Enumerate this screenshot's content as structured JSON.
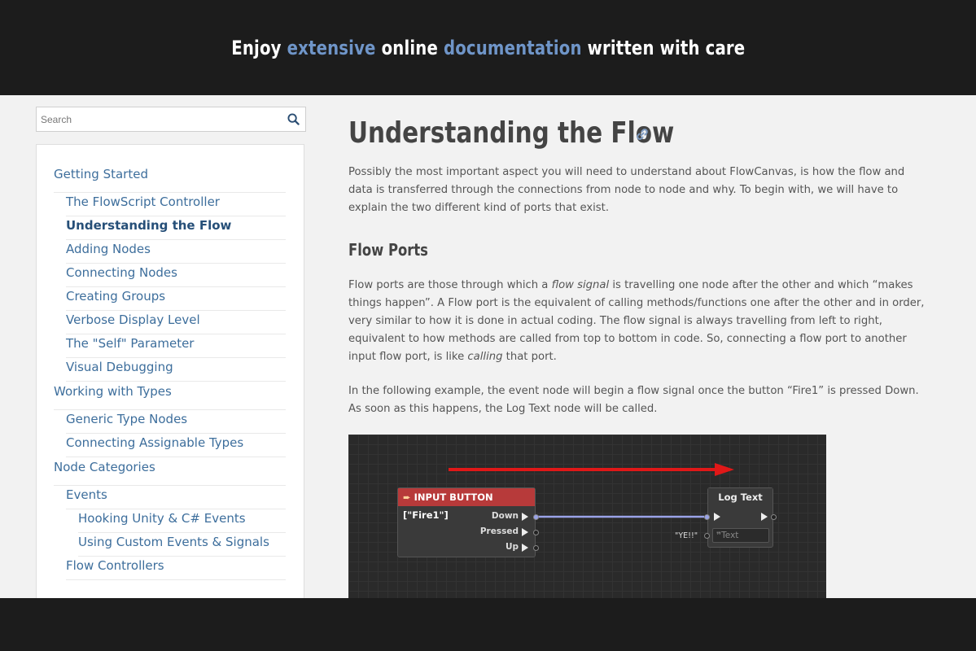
{
  "banner": {
    "w1": "Enjoy",
    "w2": "extensive",
    "w3": "online",
    "w4": "documentation",
    "w5": "written with care",
    "accent_color": "#6f95c8"
  },
  "search": {
    "placeholder": "Search",
    "icon": "search-icon"
  },
  "nav": {
    "items": [
      {
        "label": "Getting Started",
        "level": 1
      },
      {
        "label": "The FlowScript Controller",
        "level": 2
      },
      {
        "label": "Understanding the Flow",
        "level": 2,
        "active": true
      },
      {
        "label": "Adding Nodes",
        "level": 2
      },
      {
        "label": "Connecting Nodes",
        "level": 2
      },
      {
        "label": "Creating Groups",
        "level": 2
      },
      {
        "label": "Verbose Display Level",
        "level": 2
      },
      {
        "label": "The \"Self\" Parameter",
        "level": 2
      },
      {
        "label": "Visual Debugging",
        "level": 2
      },
      {
        "label": "Working with Types",
        "level": 1
      },
      {
        "label": "Generic Type Nodes",
        "level": 2
      },
      {
        "label": "Connecting Assignable Types",
        "level": 2
      },
      {
        "label": "Node Categories",
        "level": 1
      },
      {
        "label": "Events",
        "level": 2
      },
      {
        "label": "Hooking Unity & C# Events",
        "level": 3
      },
      {
        "label": "Using Custom Events & Signals",
        "level": 3
      },
      {
        "label": "Flow Controllers",
        "level": 2
      }
    ]
  },
  "article": {
    "title": "Understanding the Flow",
    "intro": "Possibly the most important aspect you will need to understand about FlowCanvas, is how the flow and data is transferred through the connections from node to node and why. To begin with, we will have to explain the two different kind of ports that exist.",
    "section_title": "Flow Ports",
    "p1_a": "Flow ports are those through which a ",
    "p1_em": "flow signal",
    "p1_b": " is travelling one node after the other and which “makes things happen”. A Flow port is the equivalent of calling methods/functions one after the other and in order, very similar to how it is done in actual coding. The flow signal is always travelling from left to right, equivalent to how methods are called from top to bottom in code. So, connecting a flow port to another input flow port, is like ",
    "p1_em2": "calling",
    "p1_c": " that port.",
    "p2": "In the following example, the event node will begin a flow signal once the button “Fire1” is pressed Down. As soon as this happens, the Log Text node will be called."
  },
  "graph": {
    "input_node": {
      "title": "INPUT BUTTON [\"Fire1\"]",
      "ports": [
        "Down",
        "Pressed",
        "Up"
      ],
      "header_color": "#b73a3a"
    },
    "log_node": {
      "title": "Log Text",
      "text_value": "\"YE!!\"",
      "text_placeholder": "Text"
    },
    "arrow_color": "#e01818",
    "wire_color": "#9aa3e8"
  }
}
